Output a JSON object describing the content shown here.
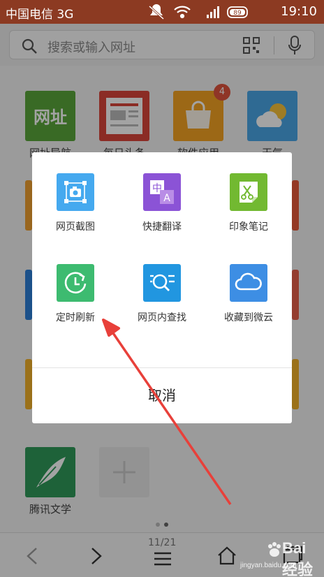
{
  "status_bar": {
    "carrier": "中国电信 3G",
    "time": "19:10",
    "battery": "89"
  },
  "search": {
    "placeholder": "搜索或输入网址"
  },
  "home_tiles": [
    {
      "label": "网址导航",
      "icon_text": "网址",
      "color": "#5aa63a"
    },
    {
      "label": "每日头条",
      "color": "#d9463b"
    },
    {
      "label": "软件应用",
      "color": "#f5a323",
      "badge": "4"
    },
    {
      "label": "天气",
      "color": "#4aa6e6"
    },
    {
      "label": "腾讯文学",
      "color": "#2f9a5a"
    }
  ],
  "dialog": {
    "options": [
      {
        "label": "网页截图",
        "icon": "camera-crop-icon",
        "color": "#45a9ef"
      },
      {
        "label": "快捷翻译",
        "icon": "translate-icon",
        "color": "#8b53d6"
      },
      {
        "label": "印象笔记",
        "icon": "evernote-icon",
        "color": "#72b931"
      },
      {
        "label": "定时刷新",
        "icon": "timer-refresh-icon",
        "color": "#3dbb70"
      },
      {
        "label": "网页内查找",
        "icon": "find-in-page-icon",
        "color": "#2196e0"
      },
      {
        "label": "收藏到微云",
        "icon": "cloud-icon",
        "color": "#3d8ee4"
      }
    ],
    "cancel_label": "取消"
  },
  "bottom_nav": {
    "page_indicator": "11/21"
  },
  "watermark": {
    "brand": "Bai 经验",
    "url": "jingyan.baidu.com"
  }
}
